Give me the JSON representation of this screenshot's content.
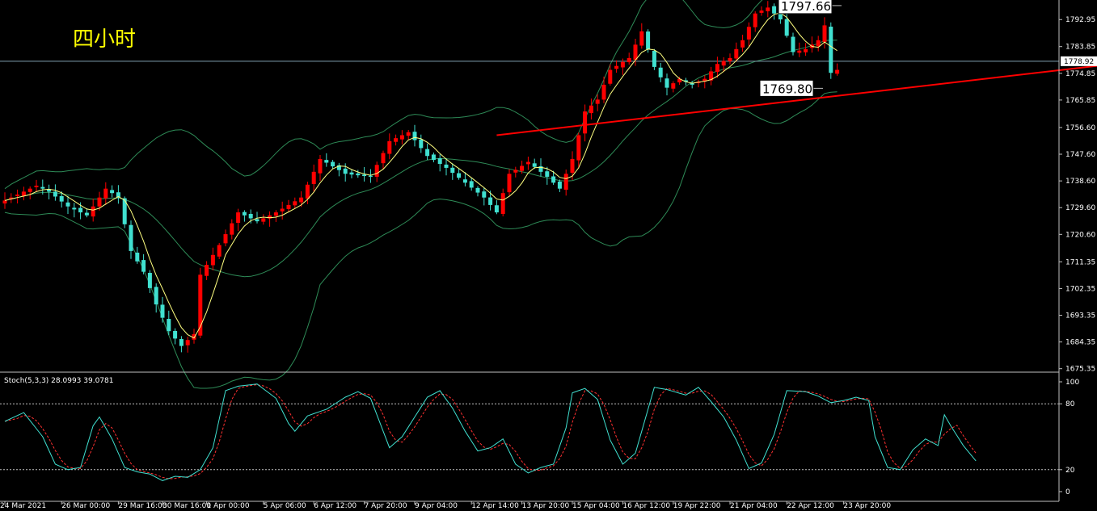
{
  "timeframe_label": "四小时",
  "chart_data": [
    {
      "type": "candlestick",
      "y_ticks": [
        1792.95,
        1783.85,
        1774.85,
        1765.85,
        1756.6,
        1747.6,
        1738.6,
        1729.6,
        1720.6,
        1711.35,
        1702.35,
        1693.35,
        1684.35,
        1675.35
      ],
      "ylim": [
        1675.0,
        1799.0
      ],
      "x_labels": [
        "24 Mar 2021",
        "26 Mar 00:00",
        "29 Mar 16:00",
        "30 Mar 16:00",
        "1 Apr 00:00",
        "5 Apr 06:00",
        "6 Apr 12:00",
        "7 Apr 20:00",
        "9 Apr 04:00",
        "12 Apr 14:00",
        "13 Apr 20:00",
        "15 Apr 04:00",
        "16 Apr 12:00",
        "19 Apr 22:00",
        "21 Apr 04:00",
        "22 Apr 12:00",
        "23 Apr 20:00"
      ],
      "current_price": "1778.92",
      "current_price_value": 1778.92,
      "annotations": [
        {
          "text": "1797.66",
          "value": 1797.66
        },
        {
          "text": "1769.80",
          "value": 1769.8
        }
      ],
      "trendline": {
        "from_index": 78,
        "from_value": 1754.0,
        "to_index": 186,
        "to_value": 1780.5
      },
      "colors": {
        "up": "#ff0000",
        "down": "#40e0d0",
        "bands": "#2e8b57",
        "ma": "#ffff80",
        "trendline": "#ff0000",
        "grid": "#7fa0b0"
      },
      "close_anchors": [
        [
          0,
          1732
        ],
        [
          3,
          1735
        ],
        [
          5,
          1737
        ],
        [
          7,
          1735
        ],
        [
          10,
          1730
        ],
        [
          13,
          1727
        ],
        [
          16,
          1736
        ],
        [
          18,
          1733
        ],
        [
          20,
          1715
        ],
        [
          22,
          1708
        ],
        [
          24,
          1697
        ],
        [
          26,
          1688
        ],
        [
          28,
          1683
        ],
        [
          30,
          1687
        ],
        [
          31,
          1707
        ],
        [
          34,
          1717
        ],
        [
          37,
          1728
        ],
        [
          40,
          1725
        ],
        [
          43,
          1728
        ],
        [
          47,
          1733
        ],
        [
          50,
          1746
        ],
        [
          54,
          1741
        ],
        [
          58,
          1740
        ],
        [
          61,
          1752
        ],
        [
          64,
          1755
        ],
        [
          67,
          1747
        ],
        [
          70,
          1743
        ],
        [
          73,
          1738
        ],
        [
          76,
          1733
        ],
        [
          78,
          1728
        ],
        [
          80,
          1741
        ],
        [
          83,
          1745
        ],
        [
          86,
          1740
        ],
        [
          88,
          1736
        ],
        [
          90,
          1746
        ],
        [
          92,
          1762
        ],
        [
          94,
          1766
        ],
        [
          96,
          1776
        ],
        [
          99,
          1780
        ],
        [
          101,
          1789
        ],
        [
          103,
          1777
        ],
        [
          105,
          1770
        ],
        [
          107,
          1773
        ],
        [
          109,
          1771
        ],
        [
          111,
          1773
        ],
        [
          113,
          1778
        ],
        [
          115,
          1780
        ],
        [
          117,
          1786
        ],
        [
          119,
          1795
        ],
        [
          121,
          1797
        ],
        [
          123,
          1793
        ],
        [
          125,
          1782
        ],
        [
          127,
          1783
        ],
        [
          129,
          1786
        ],
        [
          130,
          1791
        ],
        [
          131,
          1775
        ],
        [
          132,
          1776
        ]
      ]
    },
    {
      "type": "line",
      "title": "Stoch(5,3,3) 28.0993 39.0781",
      "y_ticks": [
        "100",
        "80",
        "20",
        "0"
      ],
      "levels": [
        80,
        20
      ],
      "colors": {
        "main": "#40e0d0",
        "signal": "#ff3030",
        "levels": "#c0c0c0"
      },
      "main_anchors": [
        [
          0,
          64
        ],
        [
          3,
          72
        ],
        [
          6,
          50
        ],
        [
          8,
          25
        ],
        [
          10,
          20
        ],
        [
          12,
          22
        ],
        [
          14,
          60
        ],
        [
          15,
          68
        ],
        [
          17,
          48
        ],
        [
          19,
          22
        ],
        [
          21,
          18
        ],
        [
          23,
          16
        ],
        [
          25,
          10
        ],
        [
          27,
          14
        ],
        [
          29,
          13
        ],
        [
          31,
          20
        ],
        [
          33,
          40
        ],
        [
          35,
          92
        ],
        [
          37,
          96
        ],
        [
          40,
          98
        ],
        [
          43,
          85
        ],
        [
          45,
          62
        ],
        [
          46,
          55
        ],
        [
          48,
          69
        ],
        [
          51,
          75
        ],
        [
          54,
          86
        ],
        [
          56,
          91
        ],
        [
          58,
          85
        ],
        [
          61,
          40
        ],
        [
          63,
          50
        ],
        [
          65,
          68
        ],
        [
          67,
          86
        ],
        [
          69,
          92
        ],
        [
          71,
          76
        ],
        [
          73,
          55
        ],
        [
          75,
          37
        ],
        [
          77,
          40
        ],
        [
          79,
          48
        ],
        [
          81,
          25
        ],
        [
          83,
          17
        ],
        [
          85,
          22
        ],
        [
          87,
          25
        ],
        [
          89,
          58
        ],
        [
          90,
          90
        ],
        [
          92,
          94
        ],
        [
          94,
          84
        ],
        [
          96,
          47
        ],
        [
          98,
          25
        ],
        [
          100,
          35
        ],
        [
          102,
          75
        ],
        [
          103,
          95
        ],
        [
          105,
          93
        ],
        [
          108,
          88
        ],
        [
          110,
          95
        ],
        [
          112,
          82
        ],
        [
          114,
          68
        ],
        [
          116,
          47
        ],
        [
          118,
          21
        ],
        [
          120,
          26
        ],
        [
          122,
          52
        ],
        [
          124,
          92
        ],
        [
          127,
          91
        ],
        [
          129,
          87
        ],
        [
          131,
          81
        ],
        [
          133,
          83
        ],
        [
          135,
          86
        ],
        [
          137,
          83
        ],
        [
          138,
          50
        ],
        [
          140,
          22
        ],
        [
          142,
          20
        ],
        [
          144,
          38
        ],
        [
          146,
          48
        ],
        [
          148,
          42
        ],
        [
          149,
          70
        ],
        [
          150,
          60
        ],
        [
          152,
          42
        ],
        [
          154,
          28
        ]
      ]
    }
  ]
}
